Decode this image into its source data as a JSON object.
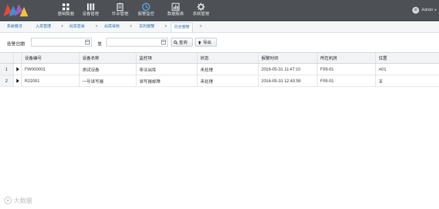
{
  "brand_colors": {
    "header_bg": "#4d5156",
    "tab_text": "#2a6aa8",
    "logo_red": "#e8473a",
    "logo_blue": "#3f8fd6",
    "logo_purple": "#a05cc4",
    "logo_yellow": "#f4c23a"
  },
  "nav": [
    {
      "label": "基础数据",
      "icon": "grid-icon",
      "active": false
    },
    {
      "label": "设备管理",
      "icon": "bars-icon",
      "active": false
    },
    {
      "label": "作业管理",
      "icon": "clipboard-icon",
      "active": false
    },
    {
      "label": "报警监控",
      "icon": "alarm-icon",
      "active": true
    },
    {
      "label": "数据报表",
      "icon": "chart-icon",
      "active": false
    },
    {
      "label": "系统管理",
      "icon": "gear-icon",
      "active": false
    }
  ],
  "user": {
    "name": "Admin",
    "caret": "▾"
  },
  "tabs": [
    {
      "label": "系统概况",
      "closable": false
    },
    {
      "label": "入库管理",
      "closable": true
    },
    {
      "label": "出库查询",
      "closable": true
    },
    {
      "label": "出库审核",
      "closable": true
    },
    {
      "label": "实时报警",
      "closable": true
    },
    {
      "label": "历史报警",
      "closable": true,
      "active": true
    }
  ],
  "tab_close_glyph": "×",
  "filter": {
    "date_label": "告警日期",
    "to_label": "至",
    "start_value": "",
    "end_value": "",
    "search_label": "查询",
    "export_label": "导出"
  },
  "table": {
    "columns": [
      "设备编号",
      "设备名称",
      "监控项",
      "状态",
      "报警时间",
      "所在机房",
      "位置"
    ],
    "rows": [
      {
        "num": "1",
        "cells": [
          "FW000001",
          "测试设备",
          "非法出库",
          "未处理",
          "2016-05-31 11:47:10",
          "F09-01",
          "A01"
        ]
      },
      {
        "num": "2",
        "cells": [
          "R22001",
          "一号读写器",
          "读写器故障",
          "未处理",
          "2016-05-31 12:43:59",
          "F09-01",
          "王"
        ]
      }
    ]
  },
  "watermark": "大数据"
}
